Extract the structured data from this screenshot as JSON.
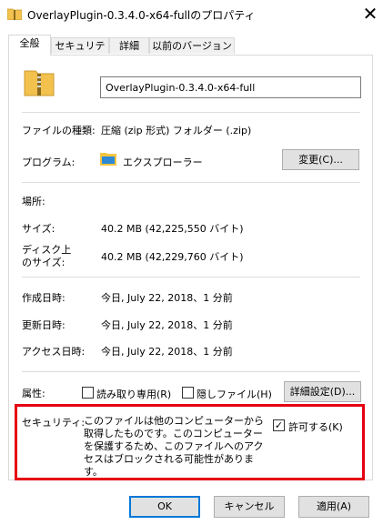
{
  "window": {
    "title": "OverlayPlugin-0.3.4.0-x64-fullのプロパティ",
    "close_glyph": "✕"
  },
  "tabs": [
    {
      "label": "全般"
    },
    {
      "label": "セキュリティ"
    },
    {
      "label": "詳細"
    },
    {
      "label": "以前のバージョン"
    }
  ],
  "general": {
    "filename": "OverlayPlugin-0.3.4.0-x64-full",
    "file_type_label": "ファイルの種類:",
    "file_type_value": "圧縮 (zip 形式) フォルダー (.zip)",
    "program_label": "プログラム:",
    "program_value": "エクスプローラー",
    "change_button": "変更(C)...",
    "location_label": "場所:",
    "location_value": "",
    "size_label": "サイズ:",
    "size_value": "40.2 MB (42,225,550 バイト)",
    "disk_size_label_1": "ディスク上",
    "disk_size_label_2": "のサイズ:",
    "disk_size_value": "40.2 MB (42,229,760 バイト)",
    "created_label": "作成日時:",
    "created_value": "今日, July 22, 2018、1 分前",
    "modified_label": "更新日時:",
    "modified_value": "今日, July 22, 2018、1 分前",
    "accessed_label": "アクセス日時:",
    "accessed_value": "今日, July 22, 2018、1 分前",
    "attributes_label": "属性:",
    "readonly_label": "読み取り専用(R)",
    "hidden_label": "隠しファイル(H)",
    "advanced_button": "詳細設定(D)...",
    "security_label": "セキュリティ:",
    "security_text": "このファイルは他のコンピューターから取得したものです。このコンピューターを保護するため、このファイルへのアクセスはブロックされる可能性があります。",
    "unblock_label": "許可する(K)",
    "unblock_checked": true
  },
  "buttons": {
    "ok": "OK",
    "cancel": "キャンセル",
    "apply": "適用(A)"
  },
  "colors": {
    "highlight_border": "#e60012",
    "default_button_border": "#0078d7",
    "zip_icon": "#f2c14e"
  }
}
